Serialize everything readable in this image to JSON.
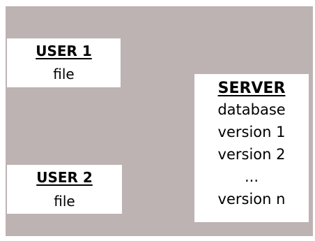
{
  "user1": {
    "title": "USER 1",
    "file": "file"
  },
  "user2": {
    "title": "USER 2",
    "file": "file"
  },
  "server": {
    "title": "SERVER",
    "lines": [
      "database",
      "version 1",
      "version 2",
      "...",
      "version n"
    ]
  },
  "colors": {
    "background": "#bdb3b2",
    "box": "#ffffff",
    "text": "#000000"
  }
}
